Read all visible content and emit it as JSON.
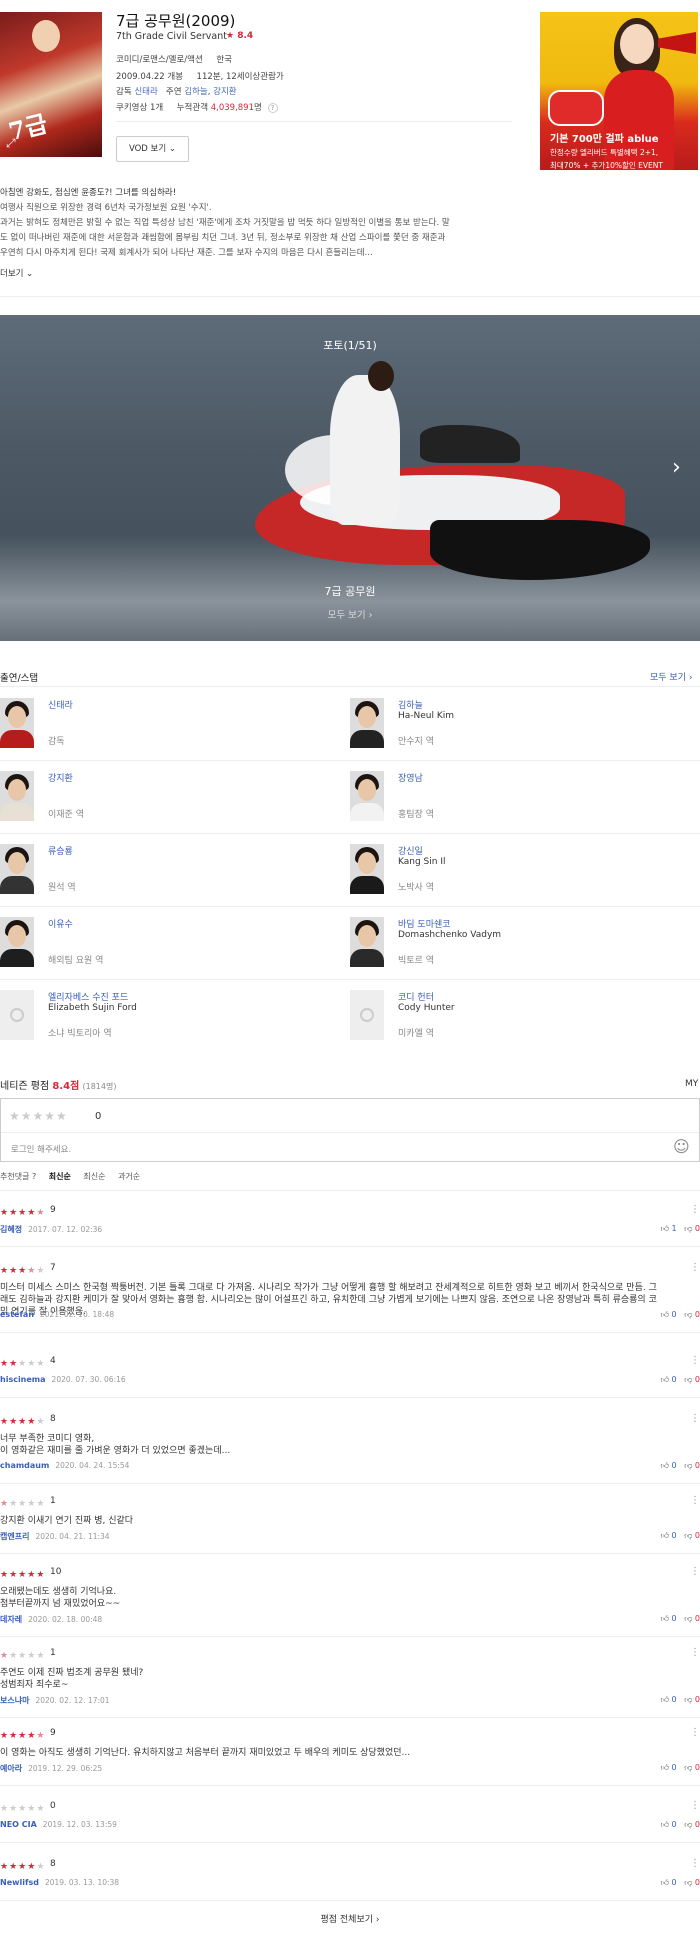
{
  "movie": {
    "title": "7급 공무원(2009)",
    "original_title": "7th Grade Civil Servant",
    "rating": "★ 8.4",
    "genre": "코미디/로맨스/멜로/액션",
    "country": "한국",
    "release": "2009.04.22 개봉",
    "runtime_age": "112분, 12세이상관람가",
    "director_label": "감독",
    "director": "신태라",
    "cast_label": "주연",
    "lead1": "김하늘",
    "lead2": "강지환",
    "cookie": "쿠키영상 1개",
    "audience_label": "누적관객",
    "audience_value": "4,039,891",
    "audience_unit": "명",
    "vod_button": "VOD 보기 ⌄"
  },
  "ad": {
    "line1": "기본 700만 걸파 ablue",
    "line2": "한정수량 엘리버드 특별혜택 2+1,",
    "line3": "최대70% + 추가10%할인 EVENT"
  },
  "synopsis": {
    "headline": "아침엔 강화도, 점심엔 윤종도?! 그녀를 의심하라!",
    "line1": "여행사 직원으로 위장한 경력 6년차 국가정보원 요원 '수지'.",
    "line2": "과거는 밝혀도 정체만은 밝힐 수 없는 직업 특성상 남친 '재준'에게 조차 거짓말을 밥 먹듯 하다 일방적인 이별을 통보 받는다. 말",
    "line3": "도 없이 떠나버린 재준에 대한 서운함과 괘씸함에 몸부림 치던 그녀. 3년 뒤, 정소부로 위장한 채 산업 스파이를 쫓던 중 재준과",
    "line4": "우연히 다시 마주치게 된다! 국제 회계사가 되어 나타난 재준. 그를 보자 수지의 마음은 다시 흔들리는데...",
    "more": "더보기 ⌄"
  },
  "photo": {
    "counter": "포토(1/51)",
    "caption": "7급 공무원",
    "view_all": "모두 보기 ›",
    "next": "›"
  },
  "cast_section": {
    "title": "출연/스탭",
    "view_all": "모두 보기 ›",
    "people": [
      {
        "name": "신태라",
        "en": "",
        "role": "감독",
        "shirt": "#b71c1c"
      },
      {
        "name": "김하늘",
        "en": "Ha-Neul Kim",
        "role": "안수지 역",
        "shirt": "#222"
      },
      {
        "name": "강지환",
        "en": "",
        "role": "이재준 역",
        "shirt": "#e8e0d4"
      },
      {
        "name": "장영남",
        "en": "",
        "role": "홍팀장 역",
        "shirt": "#f2f2f2"
      },
      {
        "name": "류승룡",
        "en": "",
        "role": "원석 역",
        "shirt": "#333"
      },
      {
        "name": "강신일",
        "en": "Kang Sin Il",
        "role": "노박사 역",
        "shirt": "#1a1a1a"
      },
      {
        "name": "이유수",
        "en": "",
        "role": "해외팀 요원 역",
        "shirt": "#1e1e1e"
      },
      {
        "name": "바딤 도마쉔코",
        "en": "Domashchenko Vadym",
        "role": "빅토르 역",
        "shirt": "#2a2a2a"
      },
      {
        "name": "엘리자베스 수진 포드",
        "en": "Elizabeth Sujin Ford",
        "role": "소냐 빅토리아 역",
        "shirt": ""
      },
      {
        "name": "코디 헌터",
        "en": "Cody Hunter",
        "role": "미카엘 역",
        "shirt": ""
      }
    ]
  },
  "ratings": {
    "title": "네티즌 평점",
    "score": "8.4점",
    "count": "(1814명)",
    "my": "MY",
    "my_score": "0",
    "placeholder": "로그인 해주세요.",
    "emoji": "☺",
    "sorts": [
      "추천댓글 ?",
      "최신순",
      "최신순",
      "과거순"
    ],
    "sort_labels": {
      "recommend": "추천댓글 ?",
      "latest": "최신순",
      "recent": "최신순",
      "past": "과거순"
    },
    "view_all": "평점 전체보기 ›"
  },
  "reviews": [
    {
      "stars": 4.5,
      "score": "9",
      "text": "",
      "user": "김혜정",
      "date": "2017. 07. 12. 02:36",
      "up": "1",
      "down": "0"
    },
    {
      "stars": 3.5,
      "score": "7",
      "text": "미스터 미세스 스미스 한국형 짝퉁버전. 기본 틀록 그대로 다 가져옴. 시나리오 작가가 그냥 어떻게 흉행 할 해보려고 잔세계적으로 히트한 영화 보고 베끼서 한국식으로 만듬. 그래도 김하늘과 강지환 케미가 잘 맞아서 영화는 흉행 함. 시나리오는 많이 어설프긴 하고, 유치한데 그냥 가볍게 보기에는 나쁘지 않음. 조연으로 나온 장영남과 특히 류승룡의 코믹 연기를 잘 이용했음.",
      "user": "estefan",
      "date": "2021. 02. 10. 18:48",
      "up": "0",
      "down": "0"
    },
    {
      "stars": 2,
      "score": "4",
      "text": "",
      "user": "hiscinema",
      "date": "2020. 07. 30. 06:16",
      "up": "0",
      "down": "0"
    },
    {
      "stars": 4,
      "score": "8",
      "text": "너무 부족한 코미디 영화,\n이 영화같은 재미를 줄 가벼운 영화가 더 있었으면 좋겠는데...",
      "user": "chamdaum",
      "date": "2020. 04. 24. 15:54",
      "up": "0",
      "down": "0"
    },
    {
      "stars": 0.5,
      "score": "1",
      "text": "강지환 이새기 연기 진짜 병, 신같다",
      "user": "캡엔프리",
      "date": "2020. 04. 21. 11:34",
      "up": "0",
      "down": "0"
    },
    {
      "stars": 5,
      "score": "10",
      "text": "오래됐는데도 생생히 기억나요.\n첨부터끝까지 넘 재밌었어요~~",
      "user": "데자레",
      "date": "2020. 02. 18. 00:48",
      "up": "0",
      "down": "0"
    },
    {
      "stars": 0.5,
      "score": "1",
      "text": "주연도 이제 진짜 법조계 공무원 됐네?\n성범죄자 죄수로~",
      "user": "보스냐마",
      "date": "2020. 02. 12. 17:01",
      "up": "0",
      "down": "0"
    },
    {
      "stars": 4.5,
      "score": "9",
      "text": "이 영화는 아직도 생생히 기억난다. 유치하지않고 처음부터 끝까지 재미있었고 두 배우의 케미도 상당했었던...",
      "user": "예아라",
      "date": "2019. 12. 29. 06:25",
      "up": "0",
      "down": "0"
    },
    {
      "stars": 0,
      "score": "0",
      "text": "",
      "user": "NEO CIA",
      "date": "2019. 12. 03. 13:59",
      "up": "0",
      "down": "0"
    },
    {
      "stars": 4,
      "score": "8",
      "text": "",
      "user": "Newlifsd",
      "date": "2019. 03. 13. 10:38",
      "up": "0",
      "down": "0"
    }
  ],
  "colors": {
    "accent": "#d6283b",
    "link": "#3a5fb7"
  }
}
